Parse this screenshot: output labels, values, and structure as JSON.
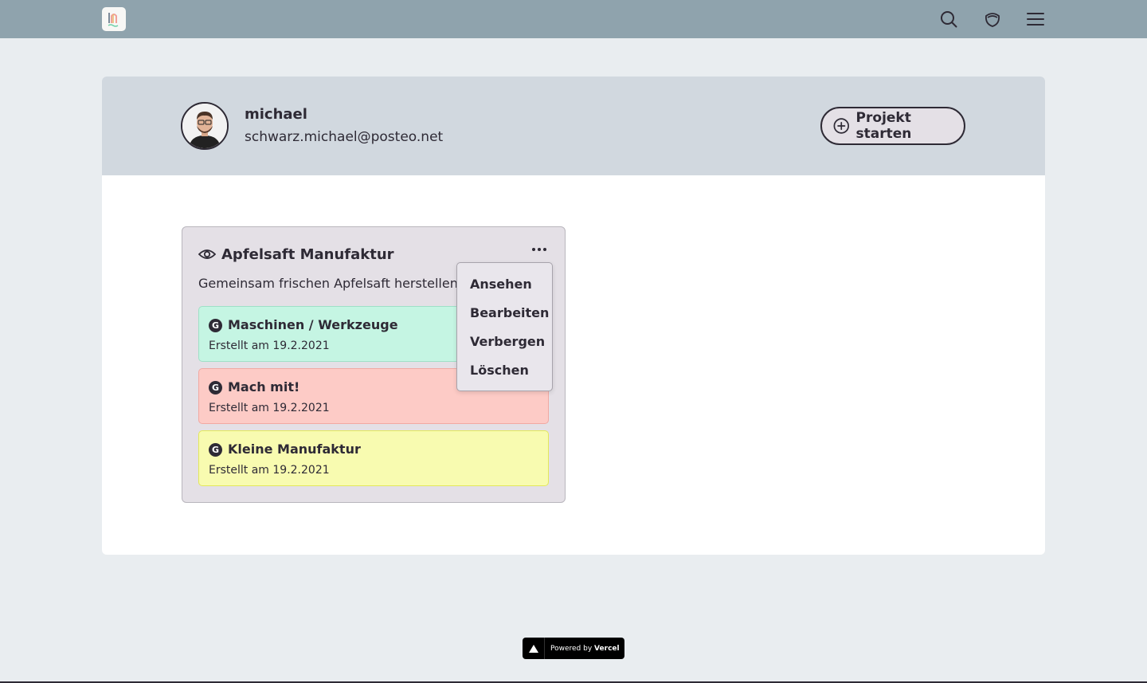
{
  "header": {
    "icons": [
      "search-icon",
      "wallet-icon",
      "menu-icon"
    ]
  },
  "profile": {
    "name": "michael",
    "email": "schwarz.michael@posteo.net",
    "start_button_label": "Projekt starten"
  },
  "project": {
    "title": "Apfelsaft Manufaktur",
    "description": "Gemeinsam frischen Apfelsaft herstellen.",
    "groups": [
      {
        "badge": "G",
        "title": "Maschinen / Werkzeuge",
        "date": "Erstellt am 19.2.2021",
        "color": "#c5f5e3"
      },
      {
        "badge": "G",
        "title": "Mach mit!",
        "date": "Erstellt am 19.2.2021",
        "color": "#fdcbc6"
      },
      {
        "badge": "G",
        "title": "Kleine Manufaktur",
        "date": "Erstellt am 19.2.2021",
        "color": "#f8fbb0"
      }
    ]
  },
  "context_menu": {
    "items": [
      "Ansehen",
      "Bearbeiten",
      "Verbergen",
      "Löschen"
    ]
  },
  "footer": {
    "powered_prefix": "Powered by",
    "powered_brand": "Vercel"
  },
  "colors": {
    "topbar": "#8fa3ad",
    "background": "#e9edf0",
    "header_band": "#d1d8df",
    "card": "#e4e0e6",
    "text": "#2e2a35"
  }
}
